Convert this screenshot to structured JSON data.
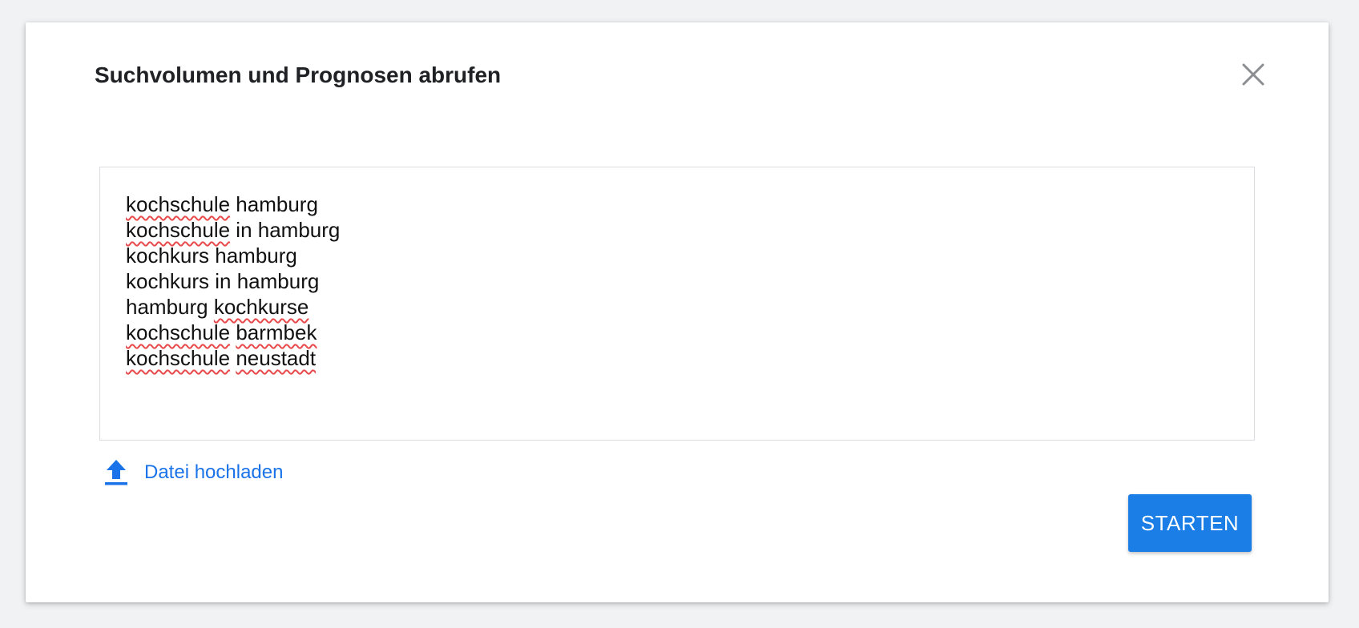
{
  "dialog": {
    "title": "Suchvolumen und Prognosen abrufen",
    "close_icon": "close-icon"
  },
  "keywords": {
    "lines": [
      {
        "parts": [
          {
            "text": "kochschule",
            "misspelled": true
          },
          {
            "text": " hamburg",
            "misspelled": false
          }
        ]
      },
      {
        "parts": [
          {
            "text": "kochschule",
            "misspelled": true
          },
          {
            "text": " in hamburg",
            "misspelled": false
          }
        ]
      },
      {
        "parts": [
          {
            "text": "kochkurs hamburg",
            "misspelled": false
          }
        ]
      },
      {
        "parts": [
          {
            "text": "kochkurs in hamburg",
            "misspelled": false
          }
        ]
      },
      {
        "parts": [
          {
            "text": "hamburg ",
            "misspelled": false
          },
          {
            "text": "kochkurse",
            "misspelled": true
          }
        ]
      },
      {
        "parts": [
          {
            "text": "kochschule",
            "misspelled": true
          },
          {
            "text": " ",
            "misspelled": false
          },
          {
            "text": "barmbek",
            "misspelled": true
          }
        ]
      },
      {
        "parts": [
          {
            "text": "kochschule",
            "misspelled": true
          },
          {
            "text": " ",
            "misspelled": false
          },
          {
            "text": "neustadt",
            "misspelled": true
          }
        ]
      }
    ]
  },
  "upload": {
    "label": "Datei hochladen",
    "icon": "upload-icon"
  },
  "actions": {
    "start_label": "STARTEN"
  },
  "colors": {
    "accent": "#1a73e8",
    "button_bg": "#1a7ee6",
    "spellcheck": "#e8494a"
  }
}
